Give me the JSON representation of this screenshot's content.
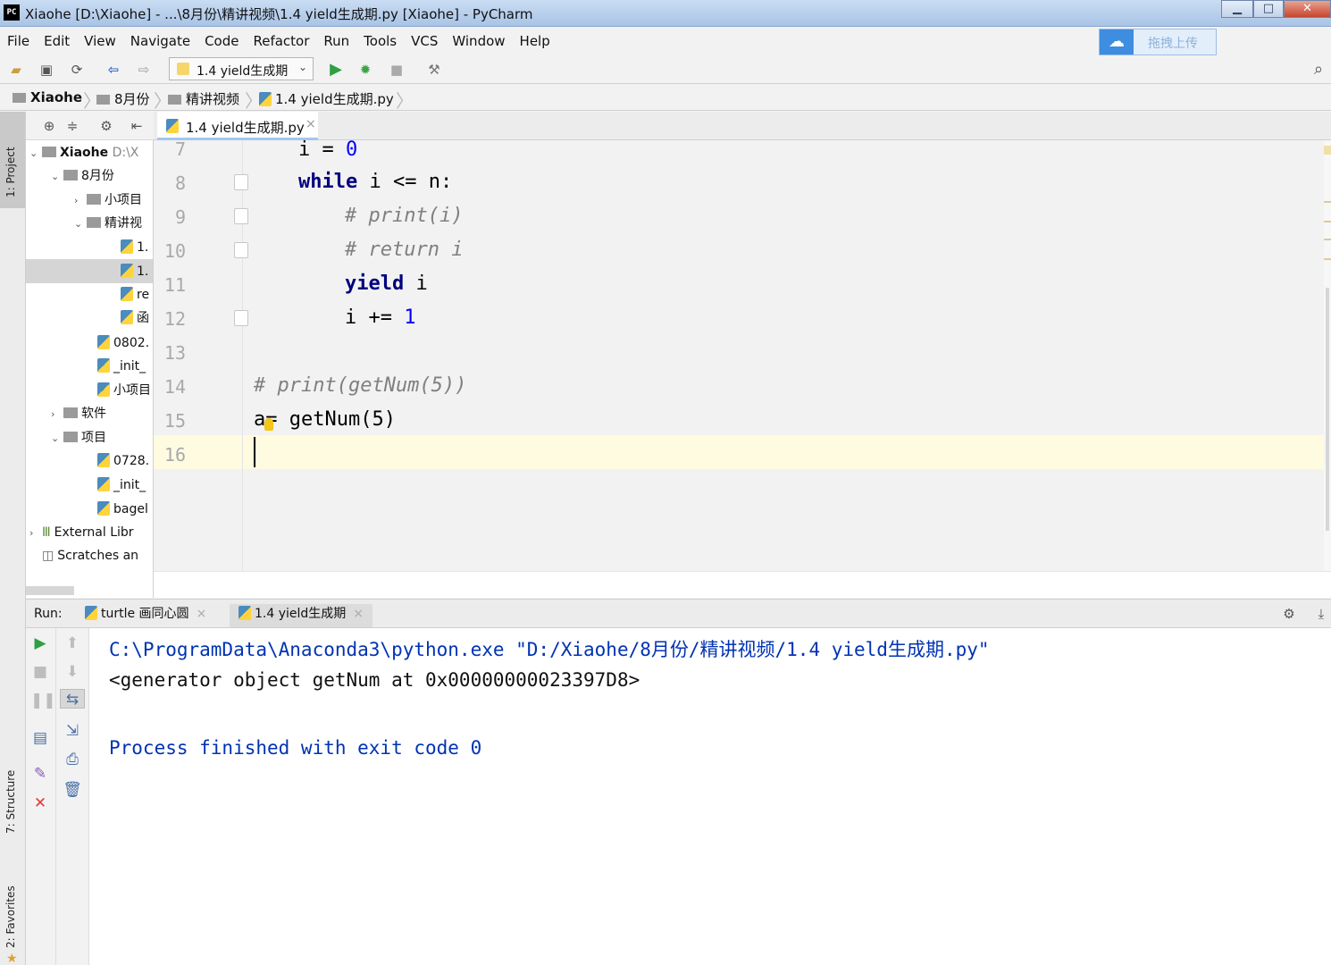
{
  "window": {
    "title": "Xiaohe [D:\\Xiaohe] - ...\\8月份\\精讲视频\\1.4 yield生成期.py [Xiaohe] - PyCharm",
    "app_icon": "PC"
  },
  "menu": [
    "File",
    "Edit",
    "View",
    "Navigate",
    "Code",
    "Refactor",
    "Run",
    "Tools",
    "VCS",
    "Window",
    "Help"
  ],
  "upload_button": "拖拽上传",
  "toolbar": {
    "run_config": "1.4 yield生成期"
  },
  "breadcrumb": [
    "Xiaohe",
    "8月份",
    "精讲视频",
    "1.4 yield生成期.py"
  ],
  "side_tabs": {
    "project": "1: Project",
    "structure": "7: Structure",
    "favorites": "2: Favorites"
  },
  "project_tree": [
    {
      "label": "Xiaohe",
      "path": "D:\\X"
    },
    {
      "label": "8月份"
    },
    {
      "label": "小项目"
    },
    {
      "label": "精讲视"
    },
    {
      "label": "1."
    },
    {
      "label": "1."
    },
    {
      "label": "re"
    },
    {
      "label": "函"
    },
    {
      "label": "0802."
    },
    {
      "label": "_init_"
    },
    {
      "label": "小项目"
    },
    {
      "label": "软件"
    },
    {
      "label": "项目"
    },
    {
      "label": "0728."
    },
    {
      "label": "_init_"
    },
    {
      "label": "bagel"
    },
    {
      "label": "External Libr"
    },
    {
      "label": "Scratches an"
    }
  ],
  "editor": {
    "tab": "1.4 yield生成期.py",
    "line_numbers": [
      "7",
      "8",
      "9",
      "10",
      "11",
      "12",
      "13",
      "14",
      "15",
      "16"
    ],
    "code": {
      "l7_var": "i",
      "l7_eq": " = ",
      "l7_num": "0",
      "l8_kw": "while",
      "l8_rest": " i <= n:",
      "l9": "# print(i)",
      "l10": "# return i",
      "l11_kw": "yield",
      "l11_rest": " i",
      "l12_rest": "i += ",
      "l12_num": "1",
      "l14": "# print(getNum(5))",
      "l15_a": "a",
      "l15_rest": "= getNum(5)"
    }
  },
  "run": {
    "label": "Run:",
    "tabs": [
      "turtle 画同心圆",
      "1.4 yield生成期"
    ],
    "output": [
      "C:\\ProgramData\\Anaconda3\\python.exe \"D:/Xiaohe/8月份/精讲视频/1.4 yield生成期.py\"",
      "<generator object getNum at 0x00000000023397D8>",
      "",
      "Process finished with exit code 0"
    ]
  },
  "colors": {
    "keyword": "#000080",
    "number": "#0000ff",
    "comment": "#808080",
    "console_cmd": "#0033b3",
    "run_green": "#2ea043",
    "stop_red": "#e53935"
  }
}
